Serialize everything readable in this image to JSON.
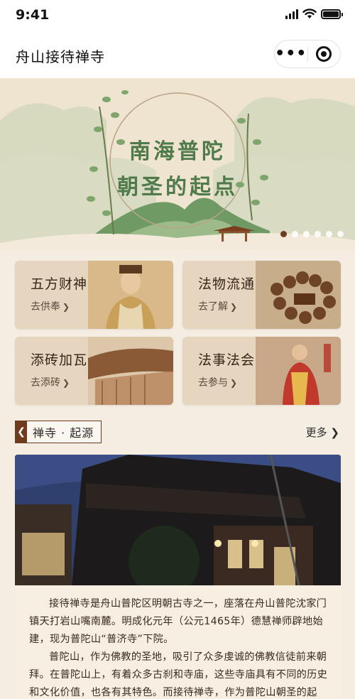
{
  "status_bar": {
    "time": "9:41"
  },
  "nav": {
    "title": "舟山接待禅寺",
    "more_icon": "more-dots-icon",
    "close_icon": "target-icon"
  },
  "banner": {
    "title_line1": "南海普陀",
    "title_line2": "朝圣的起点",
    "slide_count": 6,
    "active_slide": 0
  },
  "cards": [
    {
      "title": "五方财神",
      "sub": "去供奉"
    },
    {
      "title": "法物流通",
      "sub": "去了解"
    },
    {
      "title": "添砖加瓦",
      "sub": "去添砖"
    },
    {
      "title": "法事法会",
      "sub": "去参与"
    }
  ],
  "section": {
    "title": "禅寺 · 起源",
    "more": "更多"
  },
  "intro": {
    "p1": "接待禅寺是舟山普陀区明朝古寺之一，座落在舟山普陀沈家门镇天打岩山嘴南麓。明成化元年（公元1465年）德慧禅师辟地始建，现为普陀山“普济寺”下院。",
    "p2": "普陀山，作为佛教的圣地，吸引了众多虔诚的佛教信徒前来朝拜。在普陀山上，有着众多古刹和寺庙，这些寺庙具有不同的历史和文化价值，也各有其特色。而接待禅寺，作为普陀山朝圣的起点，是佛教信仰和文化的重要载体。"
  },
  "colors": {
    "accent": "#6e3b1f",
    "banner_green": "#4f7a4c",
    "card_bg": "#e7d6bf"
  }
}
